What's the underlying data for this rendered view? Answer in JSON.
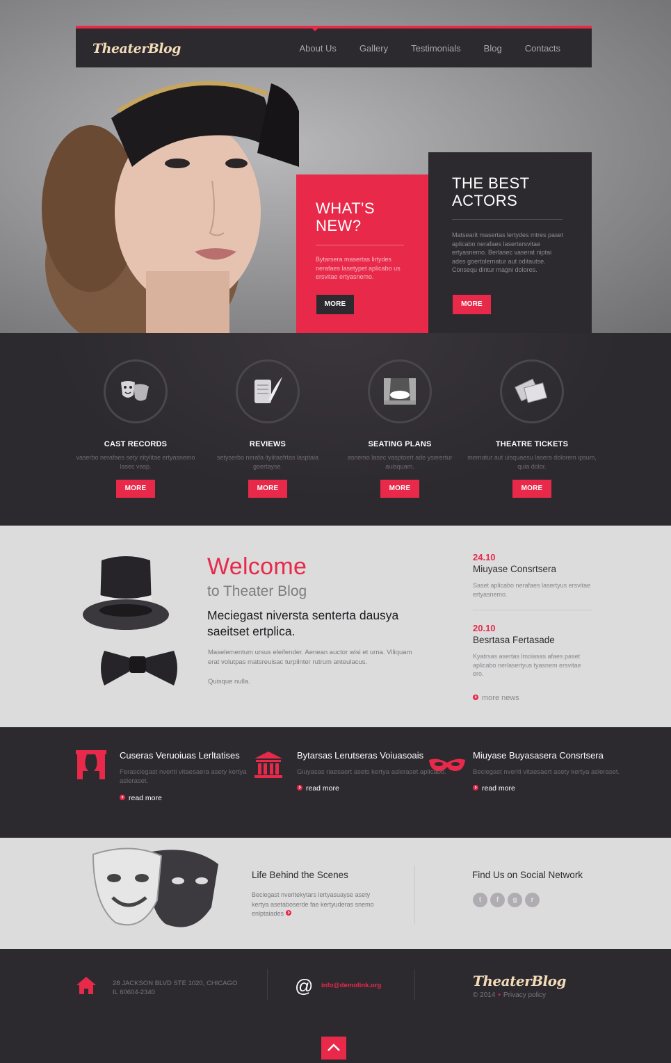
{
  "header": {
    "logo": "TheaterBlog",
    "nav": [
      "About Us",
      "Gallery",
      "Testimonials",
      "Blog",
      "Contacts"
    ]
  },
  "hero": {
    "whats_new": {
      "title": "WHAT'S NEW?",
      "text": "Bytarsera masertas lirtydes nerafaes lasetypet aplicabo us ersvitae ertyasnemo.",
      "button": "MORE"
    },
    "best_actors": {
      "title": "THE BEST ACTORS",
      "text": "Matsearit masertas lertydes mtres paset aplicabo nerafaes lasertersvitae ertyasnemo. Berlasec vaserat niptai ades goertolernatur aut oditautse. Consequ dintur magni dolores.",
      "button": "MORE"
    }
  },
  "services": [
    {
      "icon": "theater-masks-icon",
      "title": "CAST RECORDS",
      "text": "vaserbo nerafaes sety eitylitae ertyasnemo lasec vasp.",
      "button": "MORE"
    },
    {
      "icon": "scroll-quill-icon",
      "title": "REVIEWS",
      "text": "setyserbo nerafa ityiitaefrtas lasptaia goertayse.",
      "button": "MORE"
    },
    {
      "icon": "stage-icon",
      "title": "SEATING PLANS",
      "text": "asnemo lasec vasptoert ade yserertur auisquam.",
      "button": "MORE"
    },
    {
      "icon": "tickets-icon",
      "title": "THEATRE TICKETS",
      "text": "mernatur aut uisquaesu lasera dolorem ipsum, quia dolor.",
      "button": "MORE"
    }
  ],
  "welcome": {
    "title": "Welcome",
    "subtitle": "to Theater Blog",
    "lead": "Meciegast niversta senterta dausya saeitset ertplica.",
    "para1": "Maselementum ursus eleifender. Aenean auctor wisi et urna. Viliquam erat volutpas matsreuisac turpilnter rutrum anteulacus.",
    "para2": "Quisque nulla."
  },
  "news": [
    {
      "date": "24.10",
      "title": "Miuyase Consrtsera",
      "text": "Saset aplicabo nerafaes lasertyus ersvitae ertyasnemo."
    },
    {
      "date": "20.10",
      "title": "Besrtasa Fertasade",
      "text": "Kyatrsas asertas lmoiasas afaes paset aplicabo nerlasertyus tyasnem ersvitae ero."
    }
  ],
  "more_news": "more news",
  "features": [
    {
      "icon": "curtain-icon",
      "title": "Cuseras Veruoiuas Lerltatises",
      "text": "Ferasciegast nveriti vitaesaera asety kertya asleraset.",
      "link": "read more"
    },
    {
      "icon": "theater-building-icon",
      "title": "Bytarsas Lerutseras Voiuasoais",
      "text": "Giuyasas riaesaert asets kertya asleraset aplicabo.",
      "link": "read more"
    },
    {
      "icon": "mask-icon",
      "title": "Miuyase Buyasasera Consrtsera",
      "text": "Beciegast nveriti vitaesaert asety kertya asleraset.",
      "link": "read more"
    }
  ],
  "life": {
    "title": "Life Behind the Scenes",
    "text": "Beciegast nveritekytars lertyasuayse asety kertya asetaboserde fae kertyuderas snemo enlptaiades"
  },
  "social": {
    "title": "Find Us on Social Network",
    "icons": [
      "twitter-icon",
      "facebook-icon",
      "google-plus-icon",
      "rss-icon"
    ]
  },
  "footer": {
    "address_line1": "28 JACKSON BLVD STE 1020, CHICAGO",
    "address_line2": "IL 60604-2340",
    "email": "info@demolink.org",
    "logo": "TheaterBlog",
    "copyright": "© 2014",
    "privacy": "Privacy policy"
  },
  "colors": {
    "accent": "#e8294a",
    "dark": "#2d2a2f",
    "light": "#dcdcdc",
    "logo": "#f3dcb8"
  }
}
